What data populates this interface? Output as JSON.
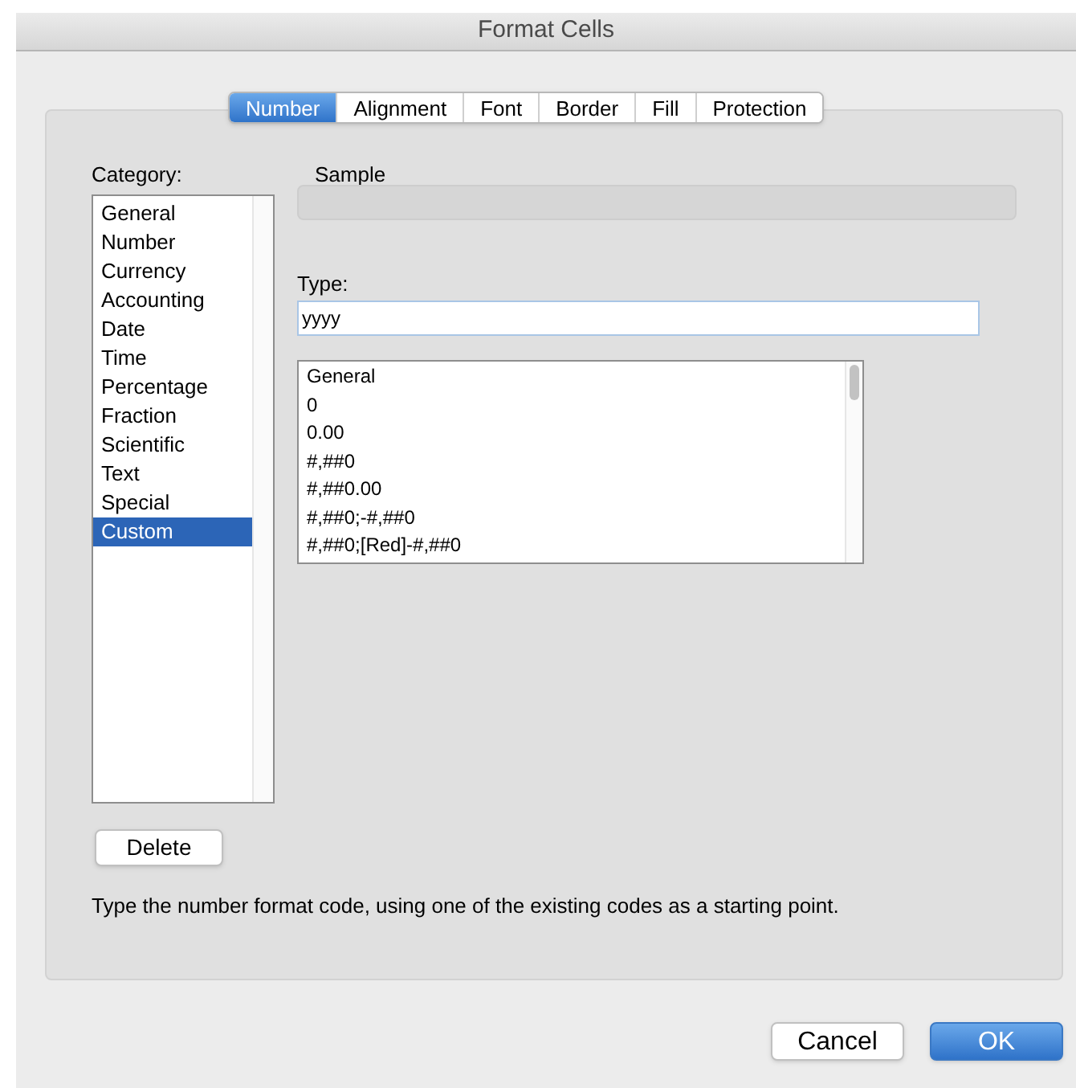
{
  "window": {
    "title": "Format Cells"
  },
  "tabs": [
    {
      "label": "Number",
      "selected": true
    },
    {
      "label": "Alignment",
      "selected": false
    },
    {
      "label": "Font",
      "selected": false
    },
    {
      "label": "Border",
      "selected": false
    },
    {
      "label": "Fill",
      "selected": false
    },
    {
      "label": "Protection",
      "selected": false
    }
  ],
  "category": {
    "label": "Category:",
    "items": [
      {
        "label": "General",
        "selected": false
      },
      {
        "label": "Number",
        "selected": false
      },
      {
        "label": "Currency",
        "selected": false
      },
      {
        "label": "Accounting",
        "selected": false
      },
      {
        "label": "Date",
        "selected": false
      },
      {
        "label": "Time",
        "selected": false
      },
      {
        "label": "Percentage",
        "selected": false
      },
      {
        "label": "Fraction",
        "selected": false
      },
      {
        "label": "Scientific",
        "selected": false
      },
      {
        "label": "Text",
        "selected": false
      },
      {
        "label": "Special",
        "selected": false
      },
      {
        "label": "Custom",
        "selected": true
      }
    ]
  },
  "sample": {
    "label": "Sample"
  },
  "type": {
    "label": "Type:",
    "value": "yyyy"
  },
  "formats": [
    "General",
    "0",
    "0.00",
    "#,##0",
    "#,##0.00",
    "#,##0;-#,##0",
    "#,##0;[Red]-#,##0"
  ],
  "delete_button": "Delete",
  "hint": "Type the number format code, using one of the existing codes as a starting point.",
  "buttons": [
    {
      "label": "Cancel",
      "kind": "secondary"
    },
    {
      "label": "OK",
      "kind": "primary"
    }
  ]
}
